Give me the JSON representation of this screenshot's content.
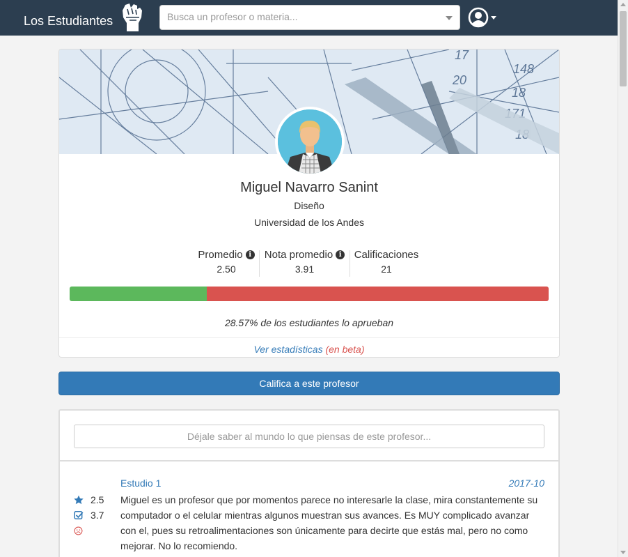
{
  "header": {
    "brand": "Los Estudiantes",
    "search_placeholder": "Busca un profesor o materia..."
  },
  "professor": {
    "name": "Miguel Navarro Sanint",
    "department": "Diseño",
    "university": "Universidad de los Andes",
    "stats": [
      {
        "label": "Promedio",
        "value": "2.50",
        "has_info": true
      },
      {
        "label": "Nota promedio",
        "value": "3.91",
        "has_info": true
      },
      {
        "label": "Calificaciones",
        "value": "21",
        "has_info": false
      }
    ],
    "approve_fraction": 0.2857,
    "approve_text": "28.57% de los estudiantes lo aprueban",
    "stats_link": "Ver estadísticas",
    "beta_label": "(en beta)"
  },
  "colors": {
    "navbar": "#2c3e50",
    "pass": "#5cb85c",
    "fail": "#d9534f",
    "primary": "#337ab7"
  },
  "rate_button": "Califica a este profesor",
  "comment_placeholder": "Déjale saber al mundo lo que piensas de este profesor...",
  "reviews": [
    {
      "course": "Estudio 1",
      "date": "2017-10",
      "rating": "2.5",
      "grade": "3.7",
      "icons": [
        "star-icon",
        "check-square-icon",
        "frown-icon"
      ],
      "text": "Miguel es un profesor que por momentos parece no interesarle la clase, mira constantemente su computador o el celular mientras algunos muestran sus avances. Es MUY complicado avanzar con el, pues su retroalimentaciones son únicamente para decirte que estás mal, pero no como mejorar. No lo recomiendo."
    }
  ]
}
